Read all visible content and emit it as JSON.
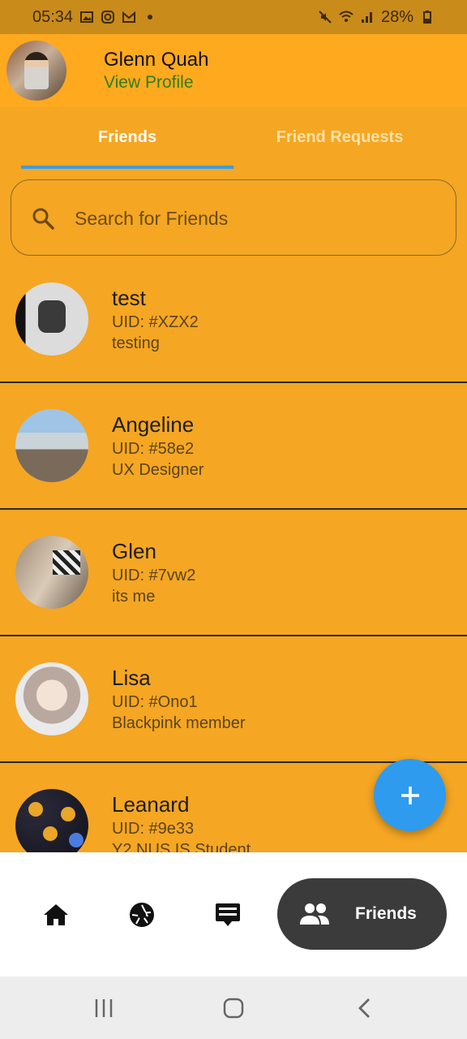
{
  "status_bar": {
    "time": "05:34",
    "battery": "28%",
    "icons": [
      "gallery-icon",
      "instagram-icon",
      "gmail-icon",
      "dot-icon",
      "mute-icon",
      "wifi-icon",
      "signal-icon",
      "battery-icon"
    ]
  },
  "header": {
    "user_name": "Glenn Quah",
    "profile_link": "View Profile"
  },
  "tabs": [
    {
      "label": "Friends",
      "active": true
    },
    {
      "label": "Friend Requests",
      "active": false
    }
  ],
  "search": {
    "placeholder": "Search for Friends",
    "value": ""
  },
  "friends": [
    {
      "name": "test",
      "uid": "UID: #XZX2",
      "bio": "testing"
    },
    {
      "name": "Angeline",
      "uid": "UID: #58e2",
      "bio": "UX Designer"
    },
    {
      "name": "Glen",
      "uid": "UID: #7vw2",
      "bio": "its me"
    },
    {
      "name": "Lisa",
      "uid": "UID: #Ono1",
      "bio": "Blackpink member"
    },
    {
      "name": "Leanard",
      "uid": "UID: #9e33",
      "bio": "Y2 NUS IS Student"
    }
  ],
  "fab": {
    "icon": "plus-icon"
  },
  "bottom_nav": {
    "items": [
      {
        "icon": "home-icon"
      },
      {
        "icon": "camera-aperture-icon"
      },
      {
        "icon": "feed-icon"
      },
      {
        "icon": "friends-icon",
        "label": "Friends",
        "active": true
      }
    ]
  },
  "colors": {
    "background": "#F5A623",
    "header": "#FFA91E",
    "tab_indicator": "#3D9BE0",
    "fab": "#2E9BEF",
    "nav_active": "#3B3B3B",
    "link": "#2F7D1E"
  }
}
